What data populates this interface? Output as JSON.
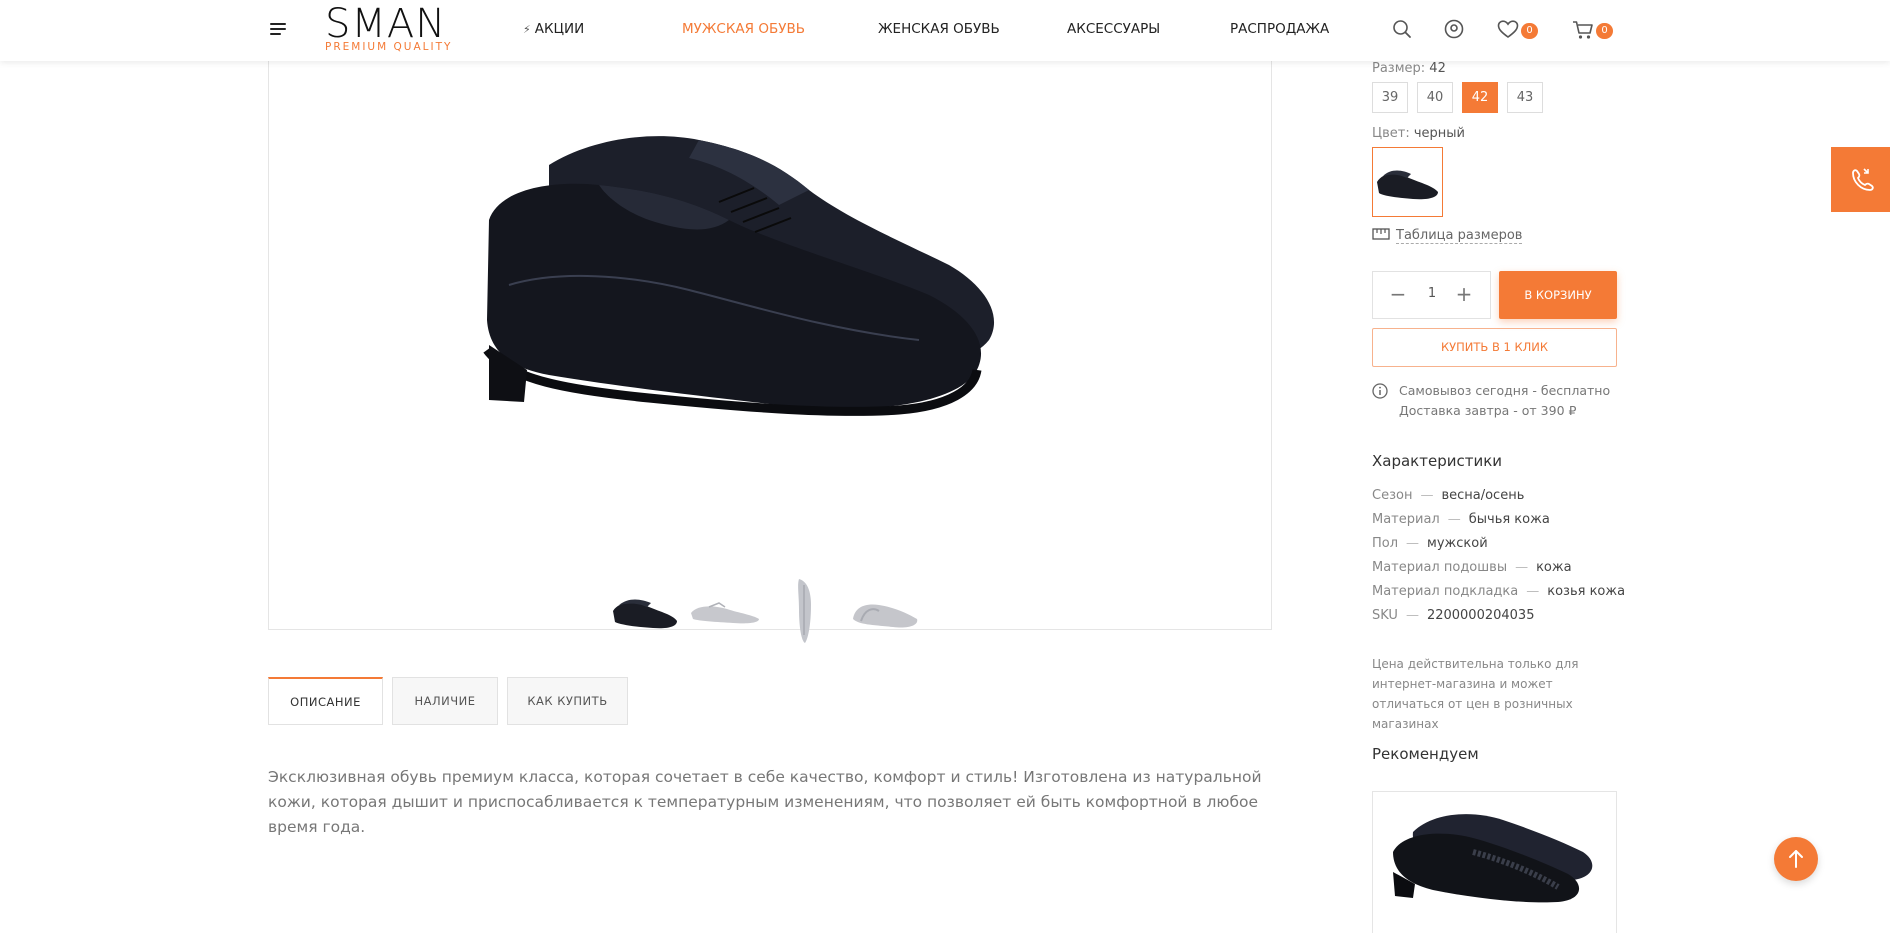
{
  "header": {
    "logo_main": "SMAN",
    "logo_sub": "PREMIUM QUALITY",
    "nav": [
      {
        "label": "АКЦИИ"
      },
      {
        "label": "МУЖСКАЯ ОБУВЬ"
      },
      {
        "label": "ЖЕНСКАЯ ОБУВЬ"
      },
      {
        "label": "АКСЕССУАРЫ"
      },
      {
        "label": "РАСПРОДАЖА"
      }
    ],
    "wishlist_count": "0",
    "cart_count": "0",
    "accent_color": "#f47a36"
  },
  "product": {
    "size_label": "Размер: ",
    "size_selected": "42",
    "sizes": [
      "39",
      "40",
      "42",
      "43"
    ],
    "color_label": "Цвет: ",
    "color_value": "черный",
    "size_table_link": "Таблица размеров",
    "quantity": "1",
    "add_to_cart": "В КОРЗИНУ",
    "buy_one_click": "КУПИТЬ В 1 КЛИК",
    "delivery_line1": "Самовывоз сегодня - бесплатно",
    "delivery_line2": "Доставка завтра - от 390 ₽",
    "characteristics_title": "Характеристики",
    "characteristics": [
      {
        "key": "Сезон",
        "value": "весна/осень"
      },
      {
        "key": "Материал",
        "value": "бычья кожа"
      },
      {
        "key": "Пол",
        "value": "мужской"
      },
      {
        "key": "Материал подошвы",
        "value": "кожа"
      },
      {
        "key": "Материал подкладка",
        "value": "козья кожа"
      },
      {
        "key": "SKU",
        "value": "2200000204035"
      }
    ],
    "price_note": "Цена действительна только для интернет-магазина и может отличаться от цен в розничных магазинах",
    "recommend_title": "Рекомендуем"
  },
  "tabs": [
    {
      "label": "ОПИСАНИЕ"
    },
    {
      "label": "НАЛИЧИЕ"
    },
    {
      "label": "КАК КУПИТЬ"
    }
  ],
  "description": "Эксклюзивная обувь премиум класса, которая сочетает в себе качество, комфорт и стиль! Изготовлена из натуральной кожи, которая дышит и приспосабливается к температурным изменениям, что позволяет ей быть комфортной в любое время года."
}
